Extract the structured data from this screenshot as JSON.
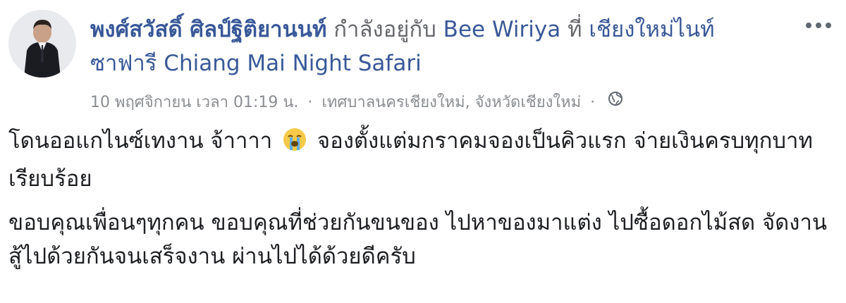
{
  "post": {
    "author_name": "พงศ์สวัสดิ์ ศิลป์ฐิติยานนท์",
    "with_text": "กำลังอยู่กับ",
    "tagged_person": "Bee Wiriya",
    "at_text": "ที่",
    "place": "เชียงใหม่ไนท์ซาฟารี Chiang Mai Night Safari",
    "timestamp": "10 พฤศจิกายน เวลา 01:19 น.",
    "location": "เทศบาลนครเชียงใหม่, จังหวัดเชียงใหม่",
    "separator": "·",
    "more_icon": "ellipsis-icon",
    "privacy_icon": "globe-icon",
    "emoji_icon": "loudly-crying-face-icon",
    "paragraph1_part1": "โดนออแกไนซ์เทงาน จ้าาาา",
    "paragraph1_part2": "จองตั้งแต่มกราคมจองเป็นคิวแรก จ่ายเงินครบทุกบาทเรียบร้อย",
    "paragraph2": "ขอบคุณเพื่อนๆทุกคน ขอบคุณที่ช่วยกันขนของ ไปหาของมาแต่ง ไปซื้อดอกไม้สด จัดงาน สู้ไปด้วยกันจนเสร็จงาน ผ่านไปได้ด้วยดีครับ"
  },
  "colors": {
    "link": "#385898",
    "meta": "#8a8d91",
    "text": "#1c1e21"
  }
}
